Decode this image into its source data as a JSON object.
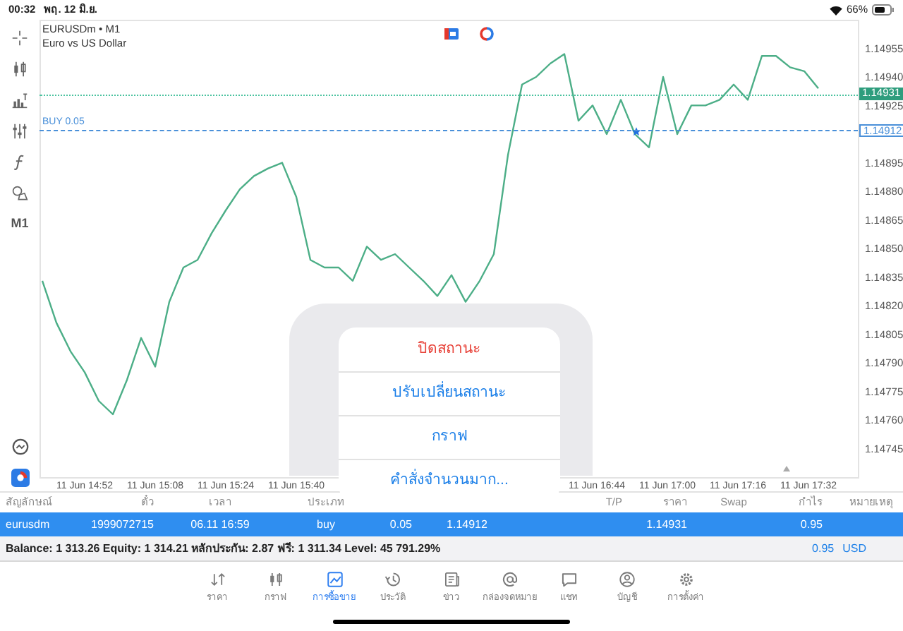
{
  "status_bar": {
    "time": "00:32",
    "date": "พฤ. 12 มิ.ย.",
    "battery": "66%"
  },
  "toolbar": {
    "timeframe": "M1"
  },
  "chart": {
    "symbol": "EURUSDm • M1",
    "description": "Euro vs US Dollar",
    "position_label": "BUY 0.05",
    "price_lines": [
      {
        "kind": "bid",
        "label": "1.14931"
      },
      {
        "kind": "position",
        "label": "1.14912"
      }
    ],
    "chart_data": {
      "type": "line",
      "categories": [
        null,
        null,
        null,
        "11 Jun 14:52",
        null,
        null,
        null,
        null,
        "11 Jun 15:08",
        null,
        null,
        null,
        null,
        "11 Jun 15:24",
        null,
        null,
        null,
        null,
        "11 Jun 15:40",
        null,
        null,
        null,
        null,
        null,
        null,
        null,
        null,
        null,
        null,
        null,
        null,
        null,
        null,
        null,
        null,
        null,
        null,
        null,
        null,
        "11 Jun 16:44",
        null,
        null,
        null,
        null,
        "11 Jun 17:00",
        null,
        null,
        null,
        null,
        "11 Jun 17:16",
        null,
        null,
        null,
        null,
        "11 Jun 17:32",
        null
      ],
      "series": [
        {
          "color": "#4cae87",
          "values": [
            1.14833,
            1.14811,
            1.14796,
            1.14785,
            1.1477,
            1.14763,
            1.14781,
            1.14803,
            1.14788,
            1.14822,
            1.1484,
            1.14844,
            1.14858,
            1.1487,
            1.14881,
            1.14888,
            1.14892,
            1.14895,
            1.14877,
            1.14844,
            1.1484,
            1.1484,
            1.14833,
            1.14851,
            1.14844,
            1.14847,
            1.1484,
            1.14833,
            1.14825,
            1.14836,
            1.14822,
            1.14833,
            1.14847,
            1.14899,
            1.14936,
            1.1494,
            1.14947,
            1.14952,
            1.14917,
            1.14925,
            1.1491,
            1.14928,
            1.1491,
            1.14903,
            1.1494,
            1.1491,
            1.14925,
            1.14925,
            1.14928,
            1.14936,
            1.14928,
            1.14951,
            1.14951,
            1.14945,
            1.14943,
            1.14934
          ]
        }
      ],
      "ylim": [
        1.1473,
        1.1497
      ],
      "yticks": [
        {
          "value": 1.14955,
          "label": "1.14955"
        },
        {
          "value": 1.1494,
          "label": "1.14940"
        },
        {
          "value": 1.14925,
          "label": "1.14925"
        },
        {
          "value": 1.14895,
          "label": "1.14895"
        },
        {
          "value": 1.1488,
          "label": "1.14880"
        },
        {
          "value": 1.14865,
          "label": "1.14865"
        },
        {
          "value": 1.1485,
          "label": "1.14850"
        },
        {
          "value": 1.14835,
          "label": "1.14835"
        },
        {
          "value": 1.1482,
          "label": "1.14820"
        },
        {
          "value": 1.14805,
          "label": "1.14805"
        },
        {
          "value": 1.1479,
          "label": "1.14790"
        },
        {
          "value": 1.14775,
          "label": "1.14775"
        },
        {
          "value": 1.1476,
          "label": "1.14760"
        },
        {
          "value": 1.14745,
          "label": "1.14745"
        }
      ]
    }
  },
  "context_menu": [
    {
      "label": "ปิดสถานะ",
      "kind": "destructive"
    },
    {
      "label": "ปรับเปลี่ยนสถานะ",
      "kind": "default"
    },
    {
      "label": "กราฟ",
      "kind": "default"
    },
    {
      "label": "คำสั่งจำนวนมาก...",
      "kind": "default"
    }
  ],
  "table": {
    "columns": [
      {
        "label": "สัญลักษณ์"
      },
      {
        "label": "ตั๋ว"
      },
      {
        "label": "เวลา"
      },
      {
        "label": "ประเภท"
      },
      {},
      {},
      {},
      {
        "label": "T/P"
      },
      {
        "label": "ราคา"
      },
      {
        "label": "Swap"
      },
      {
        "label": "กำไร"
      },
      {
        "label": "หมายเหตุ"
      }
    ],
    "rows": [
      {
        "selected": true,
        "cells": [
          "eurusdm",
          "1999072715",
          "06.11 16:59",
          "buy",
          "0.05",
          "1.14912",
          null,
          null,
          "1.14931",
          null,
          "0.95",
          null
        ]
      }
    ]
  },
  "summary": {
    "text": "Balance: 1 313.26 Equity: 1 314.21 หลักประกัน: 2.87 ฟรี: 1 311.34 Level: 45 791.29%",
    "profit": "0.95",
    "currency": "USD"
  },
  "tabs": [
    {
      "label": "ราคา",
      "selected": false
    },
    {
      "label": "กราฟ",
      "selected": false
    },
    {
      "label": "การซื้อขาย",
      "selected": true
    },
    {
      "label": "ประวัติ",
      "selected": false
    },
    {
      "label": "ข่าว",
      "selected": false
    },
    {
      "label": "กล่องจดหมาย",
      "selected": false
    },
    {
      "label": "แชท",
      "selected": false
    },
    {
      "label": "บัญชี",
      "selected": false
    },
    {
      "label": "การตั้งค่า",
      "selected": false
    }
  ]
}
